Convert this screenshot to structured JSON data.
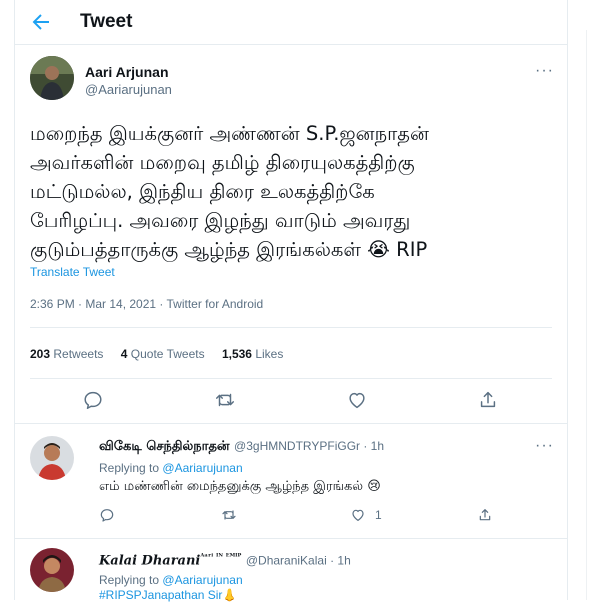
{
  "header": {
    "title": "Tweet"
  },
  "tweet": {
    "author_name": "Aari Arjunan",
    "author_handle": "@Aariarujunan",
    "more": "···",
    "text_lines": [
      "மறைந்த இயக்குனர் அண்ணன் S.P.ஜனநாதன்",
      "அவர்களின் மறைவு தமிழ் திரையுலகத்திற்கு",
      "மட்டுமல்ல, இந்திய திரை உலகத்திற்கே",
      "பேரிழப்பு. அவரை இழந்து வாடும் அவரது",
      "குடும்பத்தாருக்கு ஆழ்ந்த இரங்கல்கள் 😭 RIP"
    ],
    "translate": "Translate Tweet",
    "timestamp": "2:36 PM · Mar 14, 2021 · Twitter for Android",
    "stats": {
      "retweets_count": "203",
      "retweets_label": "Retweets",
      "quotes_count": "4",
      "quotes_label": "Quote Tweets",
      "likes_count": "1,536",
      "likes_label": "Likes"
    }
  },
  "replies": [
    {
      "name": "விகேடி செந்தில்நாதன்",
      "meta": "@3gHMNDTRYPFiGGr · 1h",
      "replying_prefix": "Replying to",
      "replying_to": "@Aariarujunan",
      "text": "எம் மண்ணின் மைந்தனுக்கு ஆழ்ந்த இரங்கல் 😢",
      "like_count": "1"
    },
    {
      "name": "Kalai Dharani",
      "name_suffix": "ᴬᵃʳⁱ ᴵᴺ ᴱᴹᴵᴾ",
      "meta": "@DharaniKalai · 1h",
      "replying_prefix": "Replying to",
      "replying_to": "@Aariarujunan",
      "text": "#RIPSPJanapathan Sir👃"
    }
  ],
  "colors": {
    "accent": "#1da1f2",
    "link": "#1b95e0",
    "muted": "#5b7083",
    "border": "#e6ecf0"
  }
}
